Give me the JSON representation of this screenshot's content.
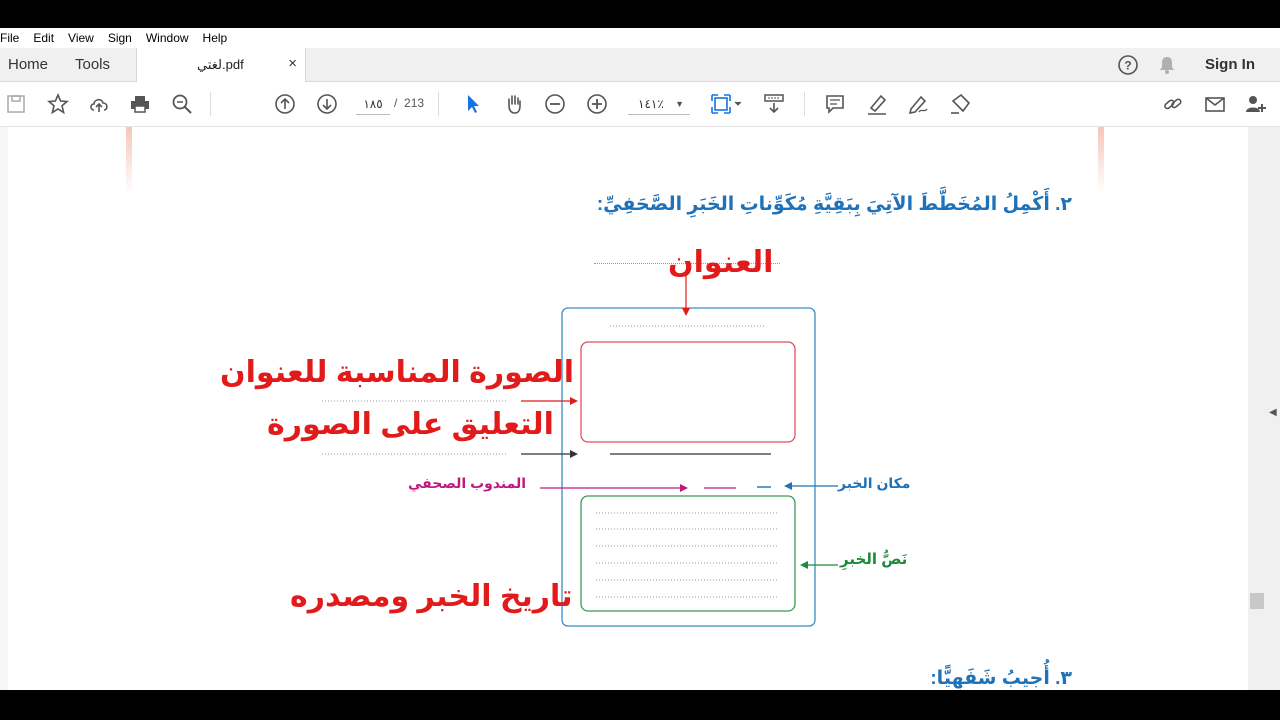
{
  "menu": [
    "File",
    "Edit",
    "View",
    "Sign",
    "Window",
    "Help"
  ],
  "tabs": {
    "home": "Home",
    "tools": "Tools",
    "document": "لغتي.pdf",
    "close": "×"
  },
  "header": {
    "sign_in": "Sign In"
  },
  "toolbar": {
    "current_page": "١٨٥",
    "page_sep": "/",
    "total_pages": "213",
    "zoom": "١٤١٪"
  },
  "content": {
    "question2": "٢. أَكْمِلُ المُخَطَّطَ الآتِيَ بِبَقِيَّةِ مُكَوِّناتِ الخَبَرِ الصَّحَفِيِّ:",
    "answer_title": "العنوان",
    "answer_image": "الصورة المناسبة للعنوان",
    "answer_caption": "التعليق على الصورة",
    "answer_date": "تاريخ الخبر ومصدره",
    "label_reporter": "المندوب الصحفي",
    "label_place": "مكان الخبر",
    "label_text": "نَصُّ الخبرِ",
    "question3": "٣. أُجيبُ شَفَهِيًّا:"
  },
  "colors": {
    "question_blue": "#1f72b8",
    "answer_red": "#e21a1a",
    "magenta": "#c2187e",
    "green": "#1e8a3c",
    "teal_blue": "#1f72b8"
  }
}
